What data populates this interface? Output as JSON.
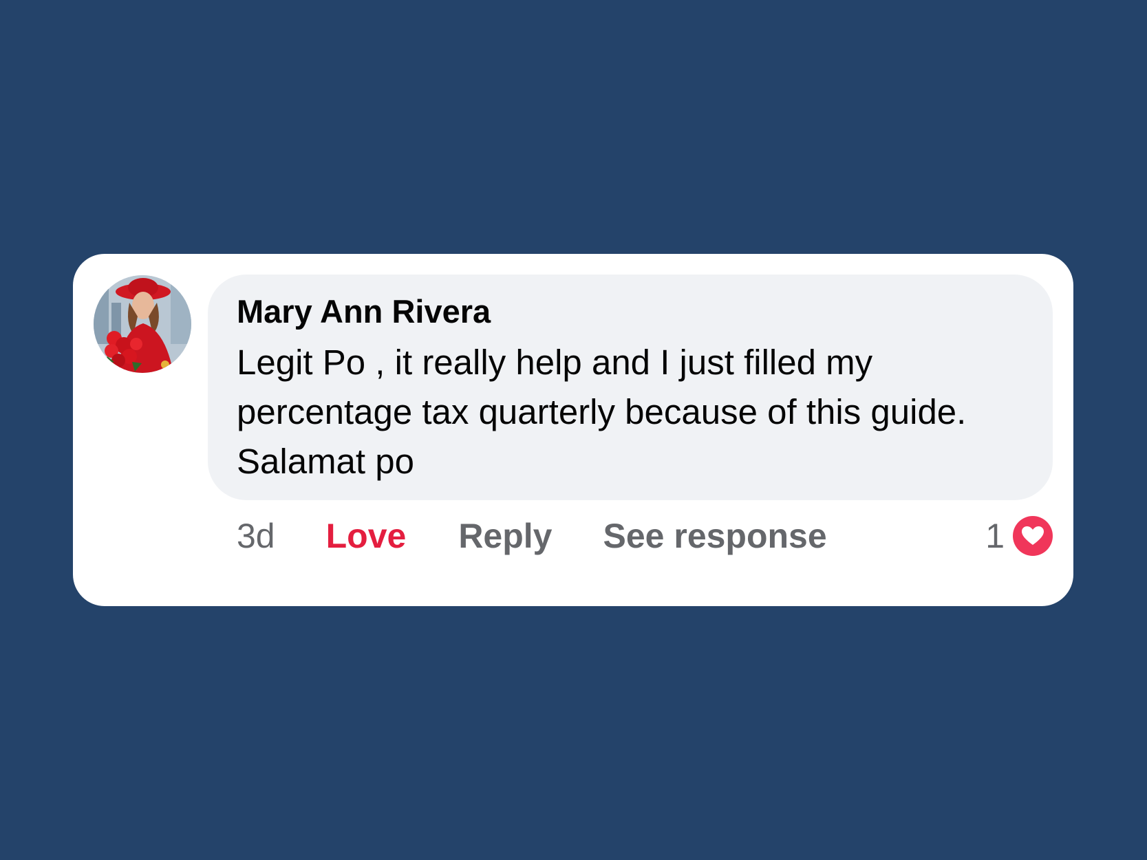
{
  "comment": {
    "author": "Mary Ann Rivera",
    "text": "Legit Po , it really help and I just filled my percentage tax quarterly because of this guide. Salamat po",
    "timestamp": "3d",
    "actions": {
      "love": "Love",
      "reply": "Reply",
      "see_response": "See response"
    },
    "reaction_count": "1",
    "reaction_icon": "heart-icon",
    "avatar_icon": "profile-photo"
  },
  "colors": {
    "background": "#24436a",
    "card": "#ffffff",
    "bubble": "#f0f2f5",
    "love_active": "#e41e3f",
    "muted_text": "#65676b",
    "heart_badge": "#f0365a"
  }
}
